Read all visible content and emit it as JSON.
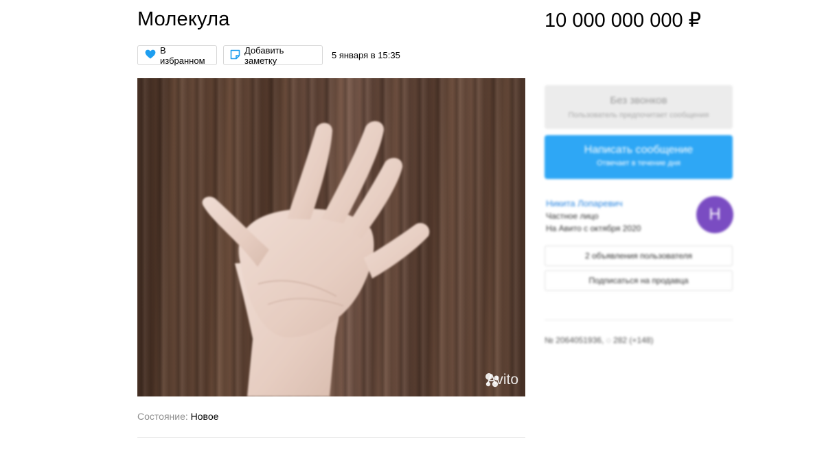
{
  "listing": {
    "title": "Молекула",
    "price": "10 000 000 000 ₽",
    "favorite_label": "В избранном",
    "note_label": "Добавить заметку",
    "date": "5 января в 15:35",
    "condition_label": "Состояние:",
    "condition_value": "Новое",
    "photo_watermark": "Avito"
  },
  "sidebar": {
    "calls_title": "Без звонков",
    "calls_subtitle": "Пользователь предпочитает сообщения",
    "message_title": "Написать сообщение",
    "message_subtitle": "Отвечает в течение дня",
    "seller_name": "Никита Лопаревич",
    "seller_type": "Частное лицо",
    "seller_since": "На Авито с октября 2020",
    "avatar_letter": "Н",
    "seller_ads": "2 объявления пользователя",
    "subscribe": "Подписаться на продавца",
    "listing_meta": "№ 2064051936,  ◌ 282 (+148)"
  },
  "colors": {
    "accent_blue": "#2ea7f5",
    "avatar_purple": "#7a4cc2",
    "heart_blue": "#1e9ef0"
  }
}
